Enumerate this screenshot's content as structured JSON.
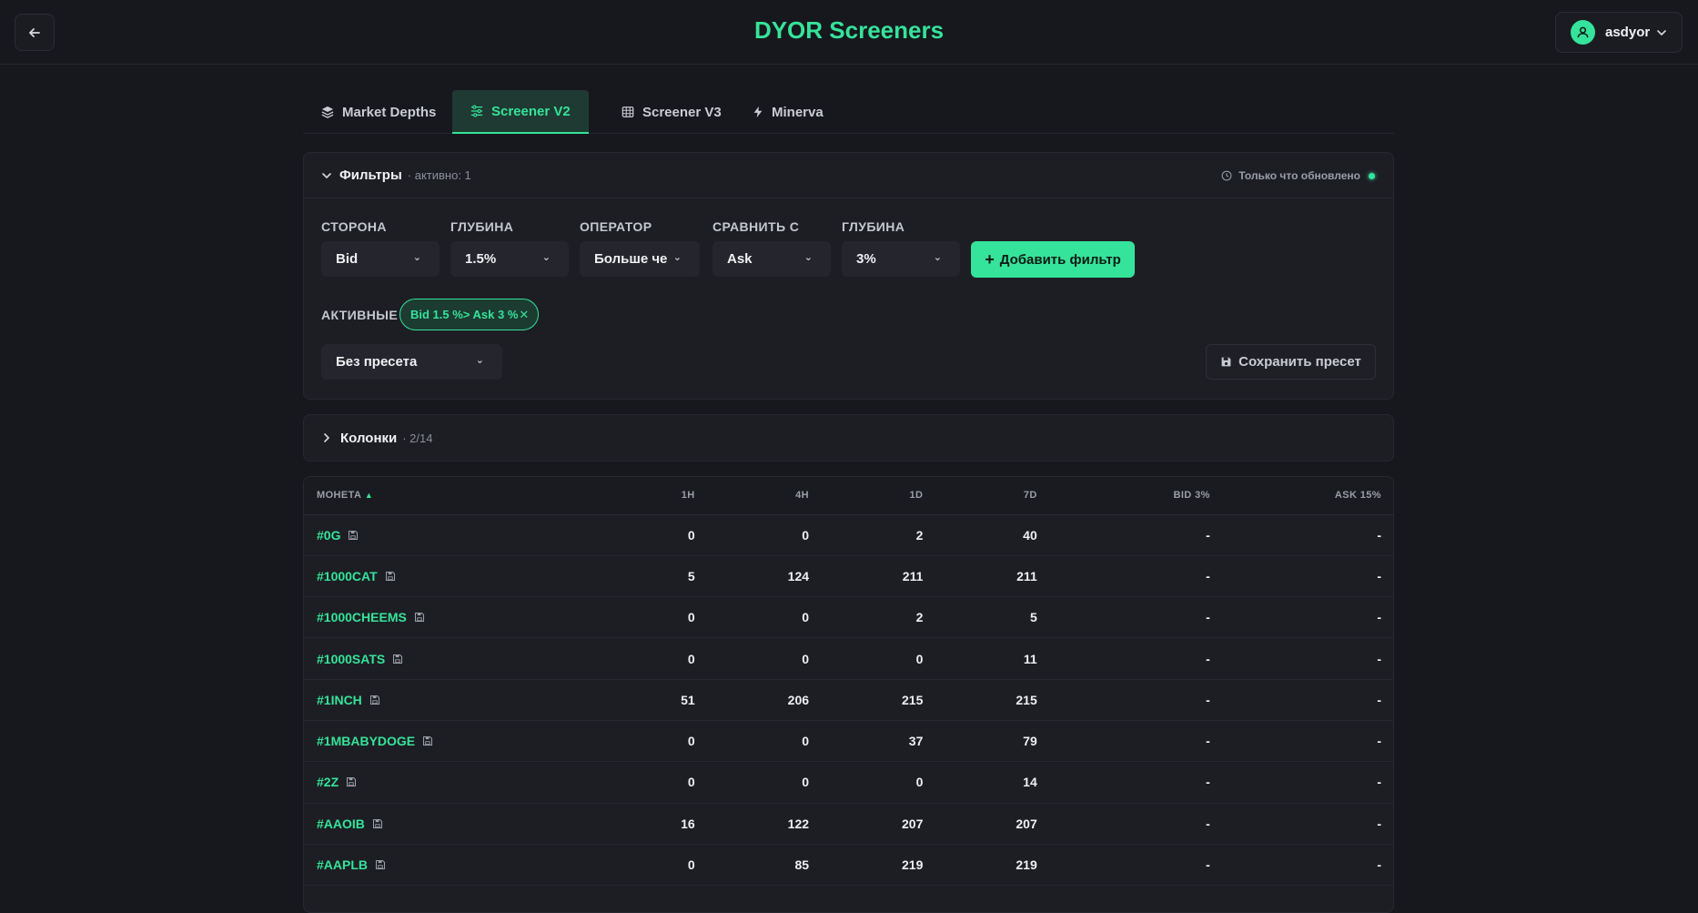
{
  "header": {
    "title": "DYOR Screeners",
    "user": "asdyor"
  },
  "tabs": [
    {
      "label": "Market Depths",
      "icon": "layers-icon",
      "active": false
    },
    {
      "label": "Screener V2",
      "icon": "sliders-icon",
      "active": true
    },
    {
      "label": "Screener V3",
      "icon": "table-icon",
      "active": false
    },
    {
      "label": "Minerva",
      "icon": "bolt-icon",
      "active": false
    }
  ],
  "filters": {
    "title": "Фильтры",
    "active_count": "· активно: 1",
    "status": "Только что обновлено",
    "fields": {
      "side": {
        "label": "СТОРОНА",
        "value": "Bid"
      },
      "depth": {
        "label": "ГЛУБИНА",
        "value": "1.5%"
      },
      "operator": {
        "label": "ОПЕРАТОР",
        "value": "Больше че"
      },
      "compare": {
        "label": "СРАВНИТЬ С",
        "value": "Ask"
      },
      "depth2": {
        "label": "ГЛУБИНА",
        "value": "3%"
      }
    },
    "add_button": "Добавить фильтр",
    "active_label": "АКТИВНЫЕ",
    "chip": "Bid  1.5 %> Ask 3 %",
    "preset": "Без пресета",
    "save_preset": "Сохранить пресет"
  },
  "columns": {
    "title": "Колонки",
    "count": "· 2/14"
  },
  "table": {
    "headers": [
      "МОНЕТА",
      "1H",
      "4H",
      "1D",
      "7D",
      "BID 3%",
      "ASK 15%"
    ],
    "rows": [
      [
        "#0G",
        "0",
        "0",
        "2",
        "40",
        "-",
        "-"
      ],
      [
        "#1000CAT",
        "5",
        "124",
        "211",
        "211",
        "-",
        "-"
      ],
      [
        "#1000CHEEMS",
        "0",
        "0",
        "2",
        "5",
        "-",
        "-"
      ],
      [
        "#1000SATS",
        "0",
        "0",
        "0",
        "11",
        "-",
        "-"
      ],
      [
        "#1INCH",
        "51",
        "206",
        "215",
        "215",
        "-",
        "-"
      ],
      [
        "#1MBABYDOGE",
        "0",
        "0",
        "37",
        "79",
        "-",
        "-"
      ],
      [
        "#2Z",
        "0",
        "0",
        "0",
        "14",
        "-",
        "-"
      ],
      [
        "#AAOIB",
        "16",
        "122",
        "207",
        "207",
        "-",
        "-"
      ],
      [
        "#AAPLB",
        "0",
        "85",
        "219",
        "219",
        "-",
        "-"
      ]
    ]
  },
  "colors": {
    "accent": "#35e39a",
    "background": "#17181d",
    "panel": "#1d1e24"
  }
}
